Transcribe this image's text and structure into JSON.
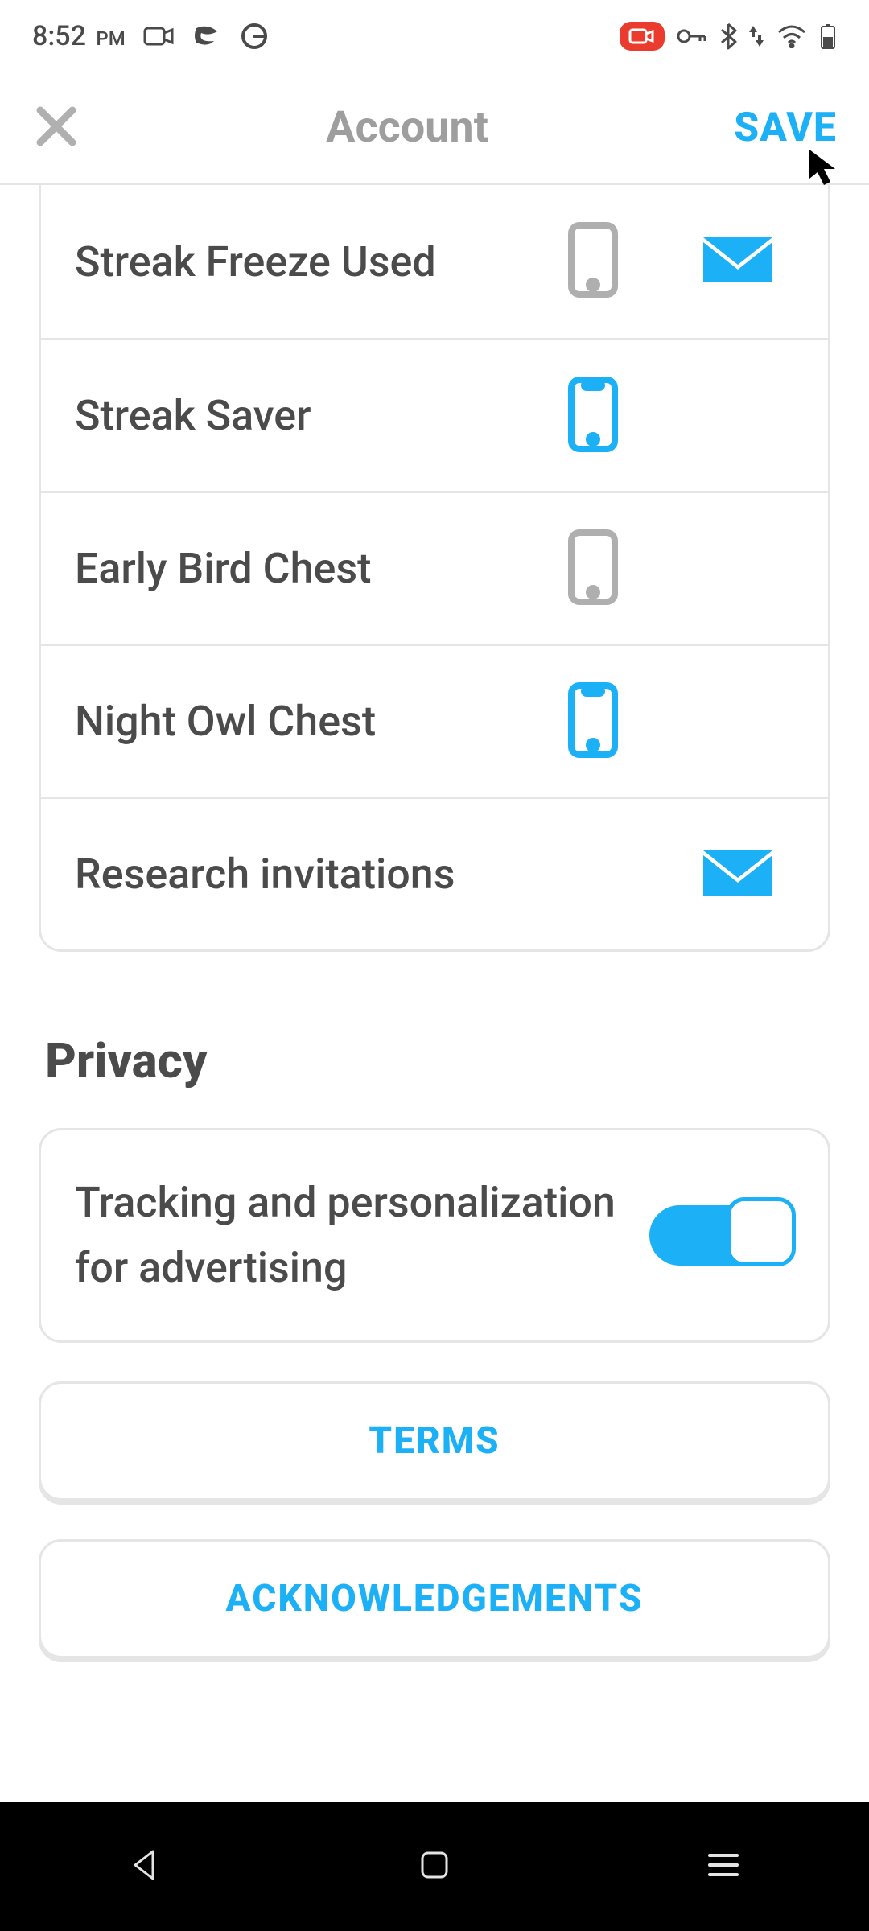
{
  "statusbar": {
    "time": "8:52",
    "ampm": "PM"
  },
  "header": {
    "title": "Account",
    "save": "SAVE"
  },
  "notifications": [
    {
      "label": "Streak Freeze Used",
      "phone": "off",
      "mail": "on"
    },
    {
      "label": "Streak Saver",
      "phone": "on",
      "mail": null
    },
    {
      "label": "Early Bird Chest",
      "phone": "off",
      "mail": null
    },
    {
      "label": "Night Owl Chest",
      "phone": "on",
      "mail": null
    },
    {
      "label": "Research invitations",
      "phone": null,
      "mail": "on"
    }
  ],
  "privacy": {
    "heading": "Privacy",
    "tracking_label": "Tracking and personalization for advertising",
    "tracking_on": true
  },
  "buttons": {
    "terms": "TERMS",
    "ack": "ACKNOWLEDGEMENTS"
  },
  "colors": {
    "accent": "#1cb0f6",
    "muted": "#afafaf",
    "text": "#4b4b4b",
    "border": "#e5e5e5"
  }
}
